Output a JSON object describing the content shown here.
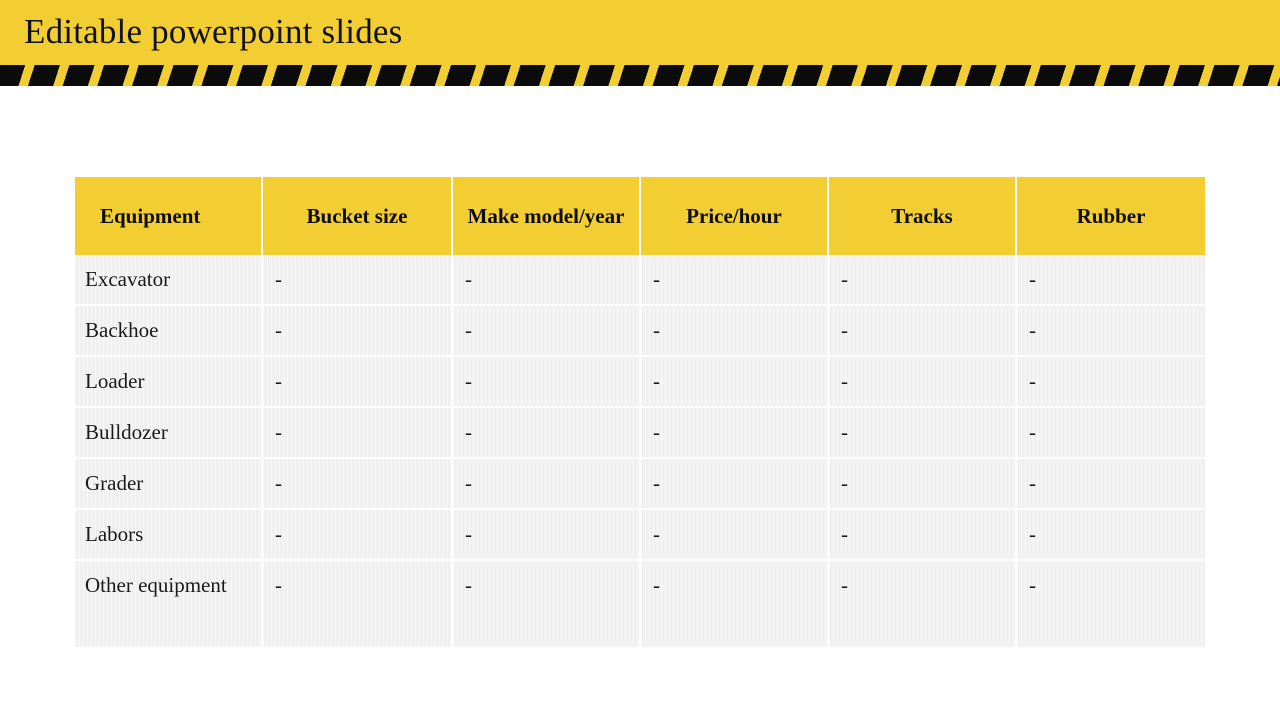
{
  "slide": {
    "title": "Editable powerpoint slides",
    "banner_color": "#F2CE32",
    "stripe_color": "#0b0b0b"
  },
  "table": {
    "headers": [
      "Equipment",
      "Bucket size",
      "Make model/year",
      "Price/hour",
      "Tracks",
      "Rubber"
    ],
    "rows": [
      {
        "equipment": "Excavator",
        "bucket_size": "-",
        "make_model_year": "-",
        "price_hour": "-",
        "tracks": "-",
        "rubber": "-"
      },
      {
        "equipment": "Backhoe",
        "bucket_size": "-",
        "make_model_year": "-",
        "price_hour": "-",
        "tracks": "-",
        "rubber": "-"
      },
      {
        "equipment": "Loader",
        "bucket_size": "-",
        "make_model_year": "-",
        "price_hour": "-",
        "tracks": "-",
        "rubber": "-"
      },
      {
        "equipment": "Bulldozer",
        "bucket_size": "-",
        "make_model_year": "-",
        "price_hour": "-",
        "tracks": "-",
        "rubber": "-"
      },
      {
        "equipment": "Grader",
        "bucket_size": "-",
        "make_model_year": "-",
        "price_hour": "-",
        "tracks": "-",
        "rubber": "-"
      },
      {
        "equipment": "Labors",
        "bucket_size": "-",
        "make_model_year": "-",
        "price_hour": "-",
        "tracks": "-",
        "rubber": "-"
      },
      {
        "equipment": "Other equipment",
        "bucket_size": "-",
        "make_model_year": "-",
        "price_hour": "-",
        "tracks": "-",
        "rubber": "-"
      }
    ]
  }
}
